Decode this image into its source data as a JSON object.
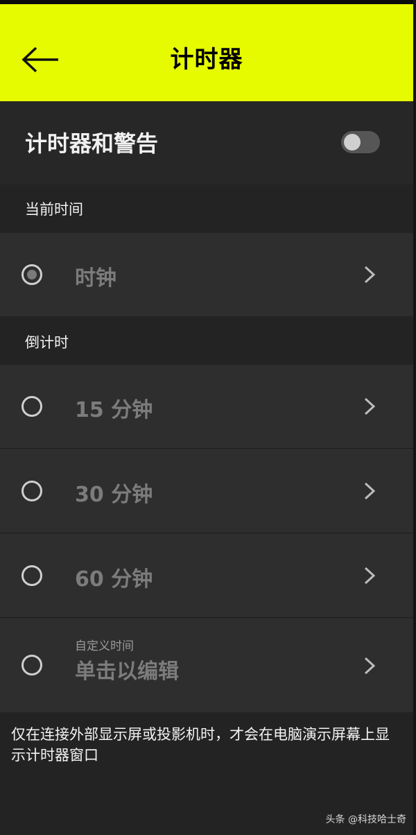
{
  "header": {
    "title": "计时器",
    "back_icon": "arrow-left-icon",
    "background": "#e6fa00"
  },
  "timer_alerts": {
    "label": "计时器和警告",
    "toggle_state": "off"
  },
  "sections": {
    "current_time": {
      "heading": "当前时间",
      "items": [
        {
          "label": "时钟",
          "selected": true
        }
      ]
    },
    "countdown": {
      "heading": "倒计时",
      "items": [
        {
          "label": "15 分钟"
        },
        {
          "label": "30 分钟"
        },
        {
          "label": "60 分钟"
        },
        {
          "sublabel": "自定义时间",
          "label": "单击以编辑"
        }
      ]
    }
  },
  "footer_note": "仅在连接外部显示屏或投影机时，才会在电脑演示屏幕上显示计时器窗口",
  "watermark": "头条 @科技哈士奇"
}
